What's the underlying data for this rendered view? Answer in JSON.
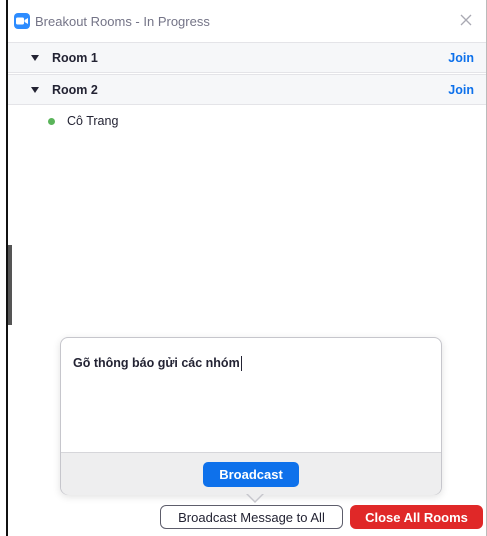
{
  "window": {
    "title": "Breakout Rooms - In Progress"
  },
  "rooms": [
    {
      "name": "Room 1",
      "join_label": "Join",
      "participants": []
    },
    {
      "name": "Room 2",
      "join_label": "Join",
      "participants": [
        {
          "name": "Cô Trang",
          "status_color": "#5ab45a"
        }
      ]
    }
  ],
  "broadcast_popover": {
    "message_value": "Gõ thông báo gửi các nhóm",
    "button_label": "Broadcast"
  },
  "footer": {
    "broadcast_all_label": "Broadcast Message to All",
    "close_all_label": "Close All Rooms"
  },
  "colors": {
    "accent_blue": "#0E71EB",
    "danger_red": "#E02828",
    "app_icon_blue": "#2D8CFF"
  },
  "icons": {
    "app": "zoom-camera-icon",
    "close": "close-icon",
    "room_toggle": "caret-down-icon",
    "status": "status-dot-icon"
  }
}
